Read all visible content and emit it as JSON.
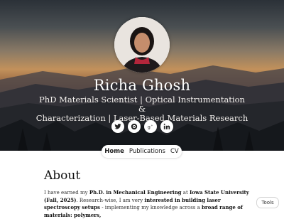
{
  "profile": {
    "name": "Richa Ghosh",
    "tagline_line1": "PhD Materials Scientist | Optical Instrumentation &",
    "tagline_line2": "Characterization | Laser-Based Materials Research"
  },
  "social": [
    {
      "icon": "twitter-icon"
    },
    {
      "icon": "orcid-icon"
    },
    {
      "icon": "google-scholar-icon"
    },
    {
      "icon": "linkedin-icon"
    }
  ],
  "nav": {
    "items": [
      "Home",
      "Publications",
      "CV"
    ],
    "active": "Home"
  },
  "about": {
    "title": "About",
    "p1_a": "I have earned my ",
    "p1_b": "Ph.D. in Mechanical Engineering",
    "p1_c": " at ",
    "p1_d": "Iowa State University (Fall, 2025)",
    "p1_e": ". Research-wise, I am very ",
    "p1_f": "interested in building laser spectroscopy setups",
    "p1_g": " - implementing my knowledge across a ",
    "p1_h": "broad range of materials: polymers,"
  },
  "tools_button": "Tools",
  "colors": {
    "hero_sky_top": "#2b3138",
    "hero_glow": "#c2915b",
    "text_dark": "#111111"
  }
}
